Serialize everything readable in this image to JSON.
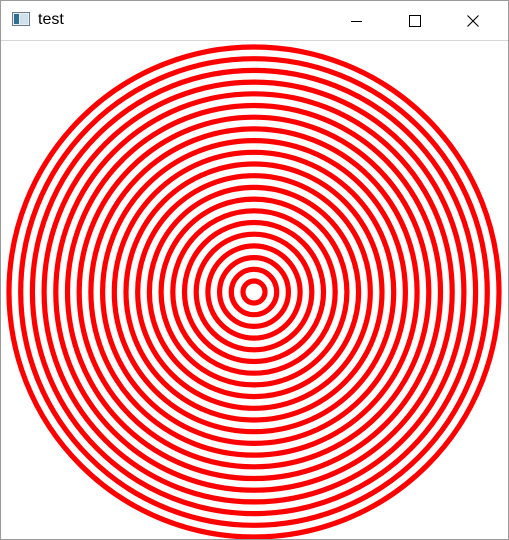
{
  "window": {
    "title": "test",
    "icon": "app-window-icon",
    "controls": {
      "minimize_icon": "minimize-icon",
      "maximize_icon": "maximize-icon",
      "close_icon": "close-icon"
    }
  },
  "colors": {
    "ring": "#ff0000",
    "background": "#ffffff",
    "titlebar": "#ffffff"
  },
  "drawing": {
    "shape": "concentric-rings",
    "ring_count": 21
  }
}
